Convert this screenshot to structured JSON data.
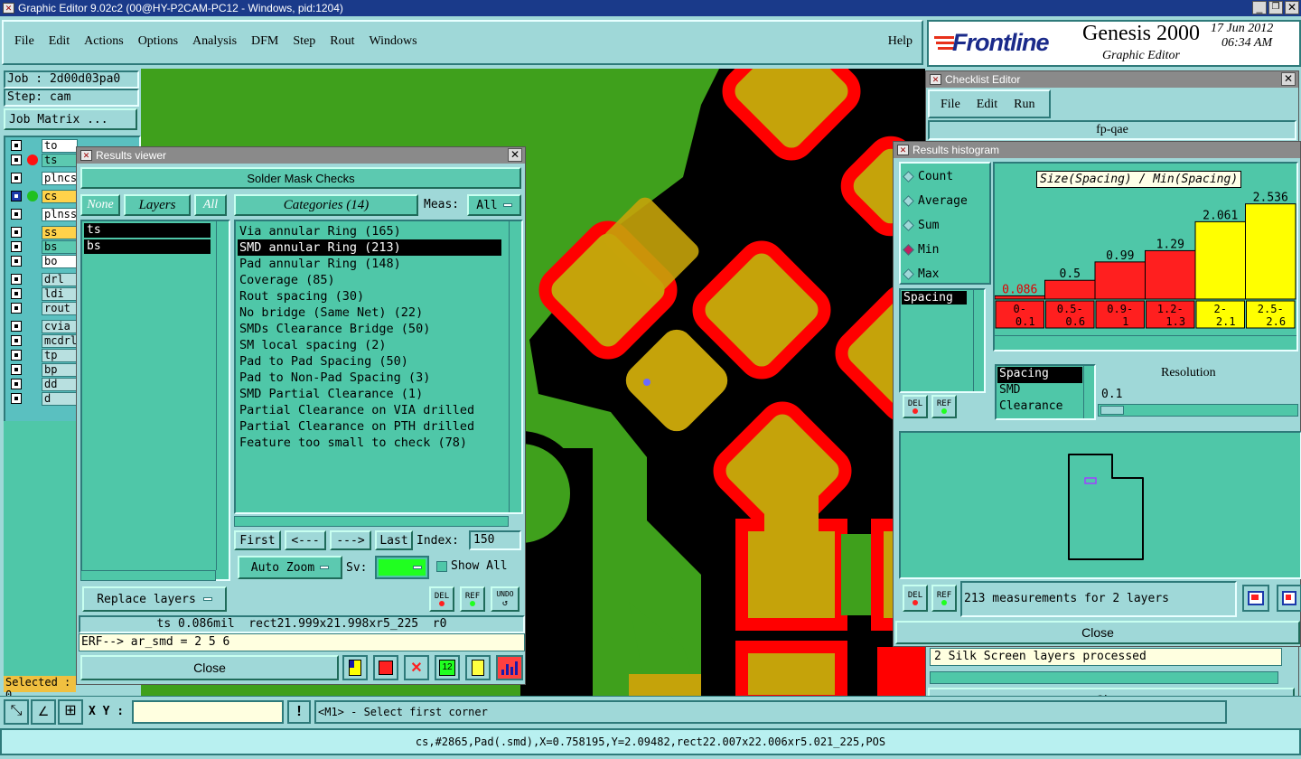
{
  "window": {
    "title": "Graphic Editor 9.02c2 (00@HY-P2CAM-PC12 - Windows, pid:1204)"
  },
  "menu": {
    "items": [
      "File",
      "Edit",
      "Actions",
      "Options",
      "Analysis",
      "DFM",
      "Step",
      "Rout",
      "Windows"
    ],
    "help": "Help"
  },
  "brand": {
    "logo": "Frontline",
    "product": "Genesis 2000",
    "subtitle": "Graphic Editor",
    "date": "17 Jun 2012",
    "time": "06:34 AM"
  },
  "job": {
    "job_label": "Job : 2d00d03pa0",
    "step_label": "Step: cam",
    "matrix_button": "Job Matrix ..."
  },
  "layers": [
    {
      "name": "to",
      "group": 1,
      "color": "#ffffff",
      "marker": "none"
    },
    {
      "name": "ts",
      "group": 1,
      "color": "#5cc9b0",
      "marker": "red"
    },
    {
      "name": "plncs",
      "group": 2,
      "color": "#ffffff",
      "marker": "none"
    },
    {
      "name": "cs",
      "group": 3,
      "color": "#ffd24a",
      "marker": "green",
      "selected": true
    },
    {
      "name": "plnss",
      "group": 4,
      "color": "#ffffff",
      "marker": "none"
    },
    {
      "name": "ss",
      "group": 5,
      "color": "#ffd24a",
      "marker": "none"
    },
    {
      "name": "bs",
      "group": 5,
      "color": "#5cc9b0",
      "marker": "none"
    },
    {
      "name": "bo",
      "group": 5,
      "color": "#ffffff",
      "marker": "none"
    },
    {
      "name": "drl",
      "group": 6,
      "color": "#b8e0e0",
      "marker": "none"
    },
    {
      "name": "ldi",
      "group": 6,
      "color": "#b8e0e0",
      "marker": "none"
    },
    {
      "name": "rout",
      "group": 6,
      "color": "#b8e0e0",
      "marker": "none"
    },
    {
      "name": "cvia",
      "group": 7,
      "color": "#b8e0e0",
      "marker": "none"
    },
    {
      "name": "mcdrl",
      "group": 7,
      "color": "#b8e0e0",
      "marker": "none"
    },
    {
      "name": "tp",
      "group": 7,
      "color": "#b8e0e0",
      "marker": "none"
    },
    {
      "name": "bp",
      "group": 7,
      "color": "#b8e0e0",
      "marker": "none"
    },
    {
      "name": "dd",
      "group": 7,
      "color": "#b8e0e0",
      "marker": "none"
    },
    {
      "name": "d",
      "group": 7,
      "color": "#b8e0e0",
      "marker": "none"
    }
  ],
  "selected_label": "Selected : 0",
  "results_viewer": {
    "title": "Results viewer",
    "header": "Solder Mask Checks",
    "none_btn": "None",
    "layers_btn": "Layers",
    "all_btn": "All",
    "layer_list": [
      "ts",
      "bs"
    ],
    "categories_btn": "Categories (14)",
    "meas_label": "Meas:",
    "meas_value": "All",
    "categories": [
      "Via annular Ring (165)",
      "SMD annular Ring (213)",
      "Pad annular Ring (148)",
      "Coverage (85)",
      "Rout spacing (30)",
      "No bridge (Same Net) (22)",
      "SMDs Clearance Bridge (50)",
      "SM local spacing (2)",
      "Pad to Pad Spacing (50)",
      "Pad to Non-Pad Spacing (3)",
      "SMD Partial Clearance (1)",
      "Partial Clearance on VIA drilled",
      "Partial Clearance on PTH drilled",
      "Feature too small to check (78)"
    ],
    "selected_category": 1,
    "first_btn": "First",
    "prev_btn": "<---",
    "next_btn": "--->",
    "last_btn": "Last",
    "index_label": "Index:",
    "index_value": "150",
    "autozoom_btn": "Auto Zoom",
    "sv_label": "Sv:",
    "show_all_label": "Show All",
    "replace_btn": "Replace layers",
    "del_label": "DEL",
    "ref_label": "REF",
    "undo_label": "UNDO",
    "info_line": "ts 0.086mil  rect21.999x21.998xr5_225  r0",
    "erf_line": "ERF--> ar_smd = 2 5 6",
    "close_btn": "Close"
  },
  "checklist_editor": {
    "title": "Checklist Editor",
    "menu": [
      "File",
      "Edit",
      "Run"
    ],
    "name": "fp-qae",
    "message": "2 Silk Screen layers processed",
    "close_btn": "Close"
  },
  "histogram": {
    "title": "Results histogram",
    "modes": [
      "Count",
      "Average",
      "Sum",
      "Min",
      "Max"
    ],
    "selected_mode": 3,
    "chart_title": "Size(Spacing) / Min(Spacing)",
    "list1": [
      "Spacing"
    ],
    "list2": [
      "Spacing",
      "SMD",
      "Clearance"
    ],
    "resolution_label": "Resolution",
    "resolution_value": "0.1",
    "measurements": "213 measurements for 2 layers",
    "close_btn": "Close",
    "del_label": "DEL",
    "ref_label": "REF"
  },
  "chart_data": {
    "type": "bar",
    "title": "Size(Spacing) / Min(Spacing)",
    "categories": [
      "0-0.1",
      "0.5-0.6",
      "0.9-1",
      "1.2-1.3",
      "2-2.1",
      "2.5-2.6"
    ],
    "category_labels_top": [
      "0-",
      "0.5-",
      "0.9-",
      "1.2-",
      "2-",
      "2.5-"
    ],
    "category_labels_bottom": [
      "0.1",
      "0.6",
      "1",
      "1.3",
      "2.1",
      "2.6"
    ],
    "values": [
      0.086,
      0.5,
      0.99,
      1.29,
      2.061,
      2.536
    ],
    "value_labels": [
      "0.086",
      "0.5",
      "0.99",
      "1.29",
      "2.061",
      "2.536"
    ],
    "bar_colors": [
      "#ff1f1f",
      "#ff1f1f",
      "#ff1f1f",
      "#ff1f1f",
      "#ffff00",
      "#ffff00"
    ],
    "ylim": [
      0,
      2.6
    ]
  },
  "bottom_bar": {
    "xy_label": "X Y :",
    "xy_value": "",
    "alert": "!",
    "prompt": "<M1> - Select first corner",
    "status": "cs,#2865,Pad(.smd),X=0.758195,Y=2.09482,rect22.007x22.006xr5.021_225,POS"
  },
  "colors": {
    "board_green": "#3fa01c",
    "pad_gold": "#c5a30a",
    "copper_red": "#ff0000",
    "panel": "#4fc7a8",
    "background": "#9fd8d8"
  }
}
